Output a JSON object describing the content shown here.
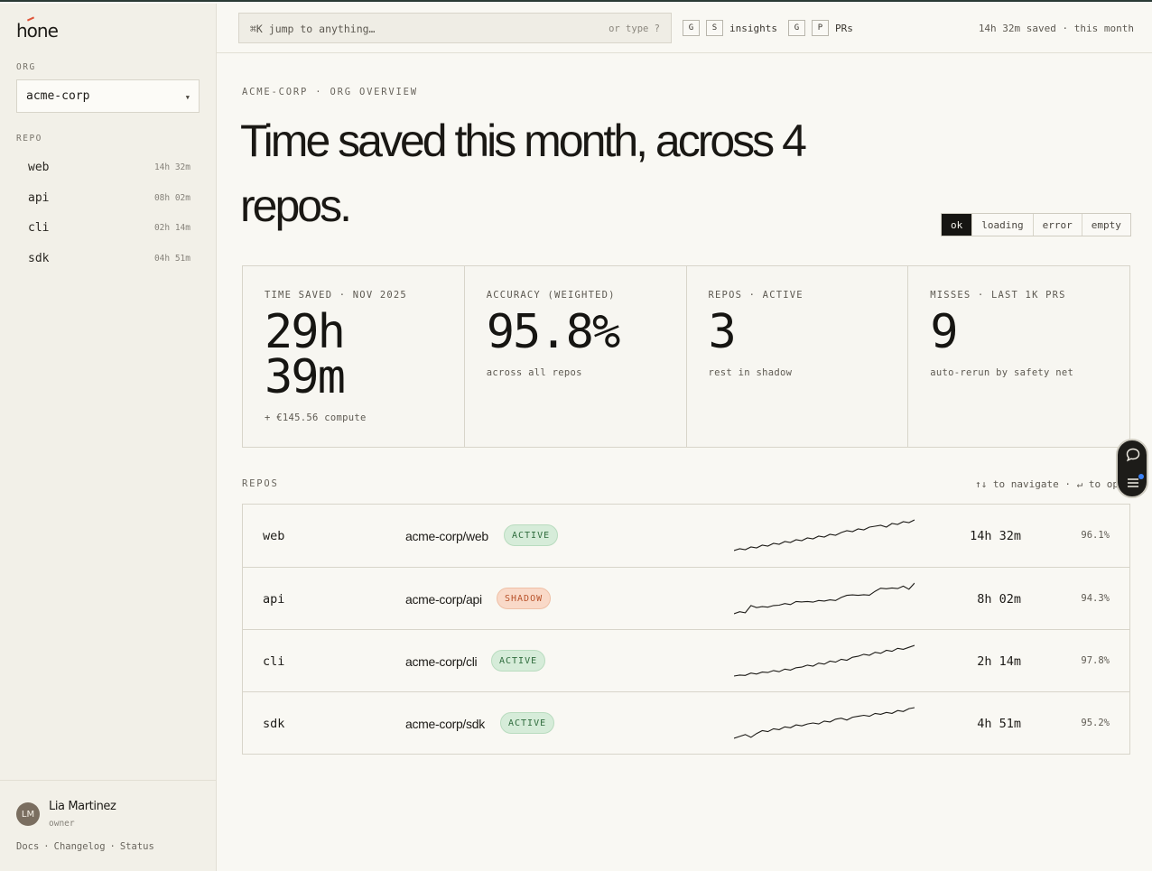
{
  "app": {
    "logo": "hone"
  },
  "sidebar": {
    "org_label": "ORG",
    "org_value": "acme-corp",
    "repo_label": "REPO",
    "repos": [
      {
        "name": "web",
        "time": "14h 32m"
      },
      {
        "name": "api",
        "time": "08h 02m"
      },
      {
        "name": "cli",
        "time": "02h 14m"
      },
      {
        "name": "sdk",
        "time": "04h 51m"
      }
    ],
    "user": {
      "initials": "LM",
      "name": "Lia Martinez",
      "role": "owner"
    },
    "footer_links": [
      "Docs",
      "Changelog",
      "Status"
    ]
  },
  "topbar": {
    "search_placeholder": "⌘K  jump to anything…",
    "search_hint": "or type ?",
    "shortcuts": [
      {
        "keys": [
          "G",
          "S"
        ],
        "label": "insights"
      },
      {
        "keys": [
          "G",
          "P"
        ],
        "label": "PRs"
      }
    ],
    "saved_summary": "14h 32m saved · this month"
  },
  "main": {
    "breadcrumb": "ACME-CORP · ORG OVERVIEW",
    "headline": "Time saved this month, across 4 repos.",
    "states": [
      "ok",
      "loading",
      "error",
      "empty"
    ],
    "active_state": "ok",
    "stats": [
      {
        "label": "TIME SAVED · NOV 2025",
        "value_line1": "29h",
        "value_line2": "39m",
        "sub": "+ €145.56 compute"
      },
      {
        "label": "ACCURACY (WEIGHTED)",
        "value_line1": "95.8%",
        "value_line2": "",
        "sub": "across all repos"
      },
      {
        "label": "REPOS · ACTIVE",
        "value_line1": "3",
        "value_line2": "",
        "sub": "rest in shadow"
      },
      {
        "label": "MISSES · LAST 1K PRS",
        "value_line1": "9",
        "value_line2": "",
        "sub": "auto-rerun by safety net"
      }
    ],
    "repos_label": "REPOS",
    "nav_hint": "↑↓ to navigate · ↵ to open",
    "repos": [
      {
        "name": "web",
        "path": "acme-corp/web",
        "status": "ACTIVE",
        "status_kind": "active",
        "time": "14h 32m",
        "accuracy": "96.1%",
        "trend": [
          1,
          2,
          1.5,
          3,
          2.5,
          4,
          3.5,
          5,
          4.5,
          6,
          5.5,
          7,
          6.5,
          8,
          7.5,
          9,
          8.5,
          10,
          9.5,
          11,
          12,
          11.5,
          13,
          12.5,
          14,
          14.5,
          15,
          14,
          16,
          15.5,
          17,
          16.5,
          18
        ]
      },
      {
        "name": "api",
        "path": "acme-corp/api",
        "status": "SHADOW",
        "status_kind": "shadow",
        "time": "8h 02m",
        "accuracy": "94.3%",
        "trend": [
          1,
          2,
          1.5,
          5,
          4,
          4.5,
          4.2,
          5,
          5.2,
          6,
          5.5,
          7,
          6.8,
          7,
          6.7,
          7.5,
          7.2,
          7.8,
          7.5,
          9,
          10,
          10.2,
          10,
          10.3,
          10.1,
          12,
          13.5,
          13.2,
          13.6,
          13.3,
          14.5,
          13,
          16
        ]
      },
      {
        "name": "cli",
        "path": "acme-corp/cli",
        "status": "ACTIVE",
        "status_kind": "active",
        "time": "2h 14m",
        "accuracy": "97.8%",
        "trend": [
          1,
          1.5,
          1.3,
          2.5,
          2,
          3,
          2.8,
          3.8,
          3.2,
          4.5,
          4,
          5.2,
          5.5,
          6.5,
          6,
          7.5,
          7,
          8.5,
          8,
          9.5,
          9,
          10.5,
          11,
          12,
          11.5,
          13,
          12.5,
          14,
          13.5,
          15,
          14.5,
          15.5,
          16.5
        ]
      },
      {
        "name": "sdk",
        "path": "acme-corp/sdk",
        "status": "ACTIVE",
        "status_kind": "active",
        "time": "4h 51m",
        "accuracy": "95.2%",
        "trend": [
          1,
          2,
          3,
          1.5,
          3.5,
          5,
          4.5,
          6,
          5.5,
          7,
          6.5,
          8,
          7.5,
          8.5,
          9,
          8.5,
          10,
          9.5,
          11,
          11.5,
          10.5,
          12,
          12.5,
          13,
          12.5,
          14,
          13.5,
          14.5,
          14,
          15.5,
          15,
          16.5,
          17
        ]
      }
    ]
  }
}
